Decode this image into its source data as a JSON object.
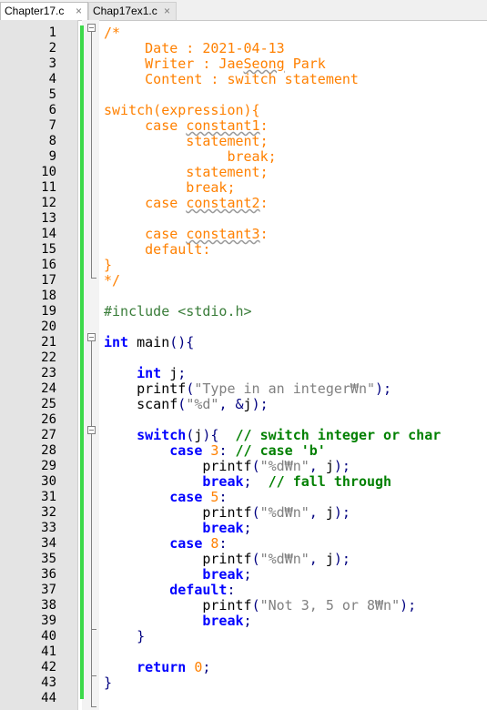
{
  "tabs": [
    {
      "label": "Chapter17.c",
      "close": "×",
      "active": true
    },
    {
      "label": "Chap17ex1.c",
      "close": "×",
      "active": false
    }
  ],
  "colors": {
    "comment": "#ff8000",
    "keyword": "#0000ff",
    "directive": "#3a7d3a",
    "string": "#808080",
    "number": "#ff8000",
    "line_comment": "#008000",
    "change_bar": "#3cd94a"
  },
  "lines": [
    {
      "n": "1",
      "t": [
        [
          "c",
          "/*"
        ]
      ]
    },
    {
      "n": "2",
      "t": [
        [
          "c",
          "     Date : 2021-04-13"
        ]
      ]
    },
    {
      "n": "3",
      "t": [
        [
          "c",
          "     Writer : Jae"
        ],
        [
          "u",
          "Seong"
        ],
        [
          "c",
          " Park"
        ]
      ]
    },
    {
      "n": "4",
      "t": [
        [
          "c",
          "     Content : switch statement"
        ]
      ]
    },
    {
      "n": "5",
      "t": []
    },
    {
      "n": "6",
      "t": [
        [
          "c",
          "switch(expression){"
        ]
      ]
    },
    {
      "n": "7",
      "t": [
        [
          "c",
          "     case "
        ],
        [
          "u",
          "constant1"
        ],
        [
          "c",
          ":"
        ]
      ]
    },
    {
      "n": "8",
      "t": [
        [
          "c",
          "          statement;"
        ]
      ]
    },
    {
      "n": "9",
      "t": [
        [
          "c",
          "               break;"
        ]
      ]
    },
    {
      "n": "10",
      "t": [
        [
          "c",
          "          statement;"
        ]
      ]
    },
    {
      "n": "11",
      "t": [
        [
          "c",
          "          break;"
        ]
      ]
    },
    {
      "n": "12",
      "t": [
        [
          "c",
          "     case "
        ],
        [
          "u",
          "constant2"
        ],
        [
          "c",
          ":"
        ]
      ]
    },
    {
      "n": "13",
      "t": []
    },
    {
      "n": "14",
      "t": [
        [
          "c",
          "     case "
        ],
        [
          "u",
          "constant3"
        ],
        [
          "c",
          ":"
        ]
      ]
    },
    {
      "n": "15",
      "t": [
        [
          "c",
          "     default:"
        ]
      ]
    },
    {
      "n": "16",
      "t": [
        [
          "c",
          "}"
        ]
      ]
    },
    {
      "n": "17",
      "t": [
        [
          "c",
          "*/"
        ]
      ]
    },
    {
      "n": "18",
      "t": []
    },
    {
      "n": "19",
      "t": [
        [
          "d",
          "#include <stdio.h>"
        ]
      ]
    },
    {
      "n": "20",
      "t": []
    },
    {
      "n": "21",
      "t": [
        [
          "k",
          "int"
        ],
        [
          "x",
          " main"
        ],
        [
          "o",
          "(){"
        ]
      ]
    },
    {
      "n": "22",
      "t": []
    },
    {
      "n": "23",
      "t": [
        [
          "x",
          "    "
        ],
        [
          "k",
          "int"
        ],
        [
          "x",
          " j"
        ],
        [
          "o",
          ";"
        ]
      ]
    },
    {
      "n": "24",
      "t": [
        [
          "x",
          "    printf"
        ],
        [
          "o",
          "("
        ],
        [
          "s",
          "\"Type in an integer₩n\""
        ],
        [
          "o",
          ");"
        ]
      ]
    },
    {
      "n": "25",
      "t": [
        [
          "x",
          "    scanf"
        ],
        [
          "o",
          "("
        ],
        [
          "s",
          "\"%d\""
        ],
        [
          "o",
          ", &"
        ],
        [
          "x",
          "j"
        ],
        [
          "o",
          ");"
        ]
      ]
    },
    {
      "n": "26",
      "t": []
    },
    {
      "n": "27",
      "t": [
        [
          "x",
          "    "
        ],
        [
          "k",
          "switch"
        ],
        [
          "o",
          "("
        ],
        [
          "x",
          "j"
        ],
        [
          "o",
          "){"
        ],
        [
          "x",
          "  "
        ],
        [
          "l",
          "// switch integer or char"
        ]
      ]
    },
    {
      "n": "28",
      "t": [
        [
          "x",
          "        "
        ],
        [
          "k",
          "case"
        ],
        [
          "x",
          " "
        ],
        [
          "n",
          "3"
        ],
        [
          "o",
          ":"
        ],
        [
          "x",
          " "
        ],
        [
          "l",
          "// case 'b'"
        ]
      ]
    },
    {
      "n": "29",
      "t": [
        [
          "x",
          "            printf"
        ],
        [
          "o",
          "("
        ],
        [
          "s",
          "\"%d₩n\""
        ],
        [
          "o",
          ", "
        ],
        [
          "x",
          "j"
        ],
        [
          "o",
          ");"
        ]
      ]
    },
    {
      "n": "30",
      "t": [
        [
          "x",
          "            "
        ],
        [
          "k",
          "break"
        ],
        [
          "o",
          ";"
        ],
        [
          "x",
          "  "
        ],
        [
          "l",
          "// fall through"
        ]
      ]
    },
    {
      "n": "31",
      "t": [
        [
          "x",
          "        "
        ],
        [
          "k",
          "case"
        ],
        [
          "x",
          " "
        ],
        [
          "n",
          "5"
        ],
        [
          "o",
          ":"
        ]
      ]
    },
    {
      "n": "32",
      "t": [
        [
          "x",
          "            printf"
        ],
        [
          "o",
          "("
        ],
        [
          "s",
          "\"%d₩n\""
        ],
        [
          "o",
          ", "
        ],
        [
          "x",
          "j"
        ],
        [
          "o",
          ");"
        ]
      ]
    },
    {
      "n": "33",
      "t": [
        [
          "x",
          "            "
        ],
        [
          "k",
          "break"
        ],
        [
          "o",
          ";"
        ]
      ]
    },
    {
      "n": "34",
      "t": [
        [
          "x",
          "        "
        ],
        [
          "k",
          "case"
        ],
        [
          "x",
          " "
        ],
        [
          "n",
          "8"
        ],
        [
          "o",
          ":"
        ]
      ]
    },
    {
      "n": "35",
      "t": [
        [
          "x",
          "            printf"
        ],
        [
          "o",
          "("
        ],
        [
          "s",
          "\"%d₩n\""
        ],
        [
          "o",
          ", "
        ],
        [
          "x",
          "j"
        ],
        [
          "o",
          ");"
        ]
      ]
    },
    {
      "n": "36",
      "t": [
        [
          "x",
          "            "
        ],
        [
          "k",
          "break"
        ],
        [
          "o",
          ";"
        ]
      ]
    },
    {
      "n": "37",
      "t": [
        [
          "x",
          "        "
        ],
        [
          "k",
          "default"
        ],
        [
          "o",
          ":"
        ]
      ]
    },
    {
      "n": "38",
      "t": [
        [
          "x",
          "            printf"
        ],
        [
          "o",
          "("
        ],
        [
          "s",
          "\"Not 3, 5 or 8₩n\""
        ],
        [
          "o",
          ");"
        ]
      ]
    },
    {
      "n": "39",
      "t": [
        [
          "x",
          "            "
        ],
        [
          "k",
          "break"
        ],
        [
          "o",
          ";"
        ]
      ]
    },
    {
      "n": "40",
      "t": [
        [
          "x",
          "    "
        ],
        [
          "o",
          "}"
        ]
      ]
    },
    {
      "n": "41",
      "t": []
    },
    {
      "n": "42",
      "t": [
        [
          "x",
          "    "
        ],
        [
          "k",
          "return"
        ],
        [
          "x",
          " "
        ],
        [
          "n",
          "0"
        ],
        [
          "o",
          ";"
        ]
      ]
    },
    {
      "n": "43",
      "t": [
        [
          "o",
          "}"
        ]
      ]
    },
    {
      "n": "44",
      "t": []
    }
  ]
}
